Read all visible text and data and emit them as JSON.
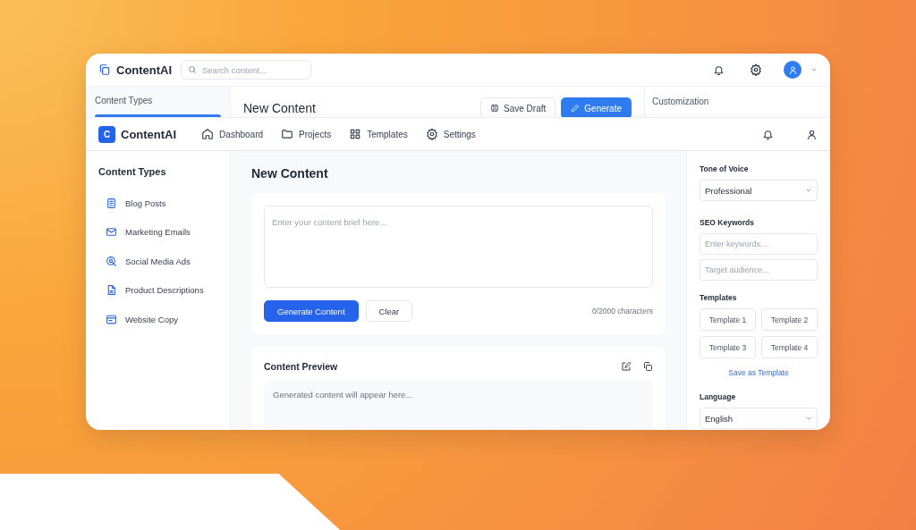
{
  "back_window": {
    "brand": "ContentAI",
    "search": {
      "placeholder": "Search content..."
    },
    "sidebar_title": "Content Types",
    "page_title": "New Content",
    "buttons": [
      {
        "label": "Save Draft",
        "kind": "secondary"
      },
      {
        "label": "Generate",
        "kind": "primary"
      }
    ],
    "panel_title": "Customization"
  },
  "navbar": {
    "logo_letter": "C",
    "brand": "ContentAI",
    "items": [
      {
        "label": "Dashboard",
        "selected": false
      },
      {
        "label": "Projects",
        "selected": false
      },
      {
        "label": "Templates",
        "selected": false
      },
      {
        "label": "Settings",
        "selected": false
      }
    ]
  },
  "sidebar": {
    "title": "Content Types",
    "items": [
      {
        "label": "Blog Posts"
      },
      {
        "label": "Marketing Emails"
      },
      {
        "label": "Social Media Ads"
      },
      {
        "label": "Product Descriptions"
      },
      {
        "label": "Website Copy"
      }
    ]
  },
  "main": {
    "title": "New Content",
    "brief": {
      "placeholder": "Enter your content brief here..."
    },
    "buttons": [
      {
        "label": "Generate Content",
        "kind": "primary"
      },
      {
        "label": "Clear",
        "kind": "secondary"
      }
    ],
    "counter": "0/2000 characters",
    "preview": {
      "title": "Content Preview",
      "placeholder": "Generated content will appear here..."
    }
  },
  "panel": {
    "tone": {
      "label": "Tone of Voice",
      "value": "Professional"
    },
    "seo": {
      "label": "SEO Keywords",
      "fields": [
        {
          "placeholder": "Enter keywords..."
        },
        {
          "placeholder": "Target audience..."
        }
      ]
    },
    "templates": {
      "label": "Templates",
      "items": [
        "Template 1",
        "Template 2",
        "Template 3",
        "Template 4"
      ],
      "link": "Save as Template"
    },
    "language": {
      "label": "Language",
      "value": "English"
    }
  }
}
